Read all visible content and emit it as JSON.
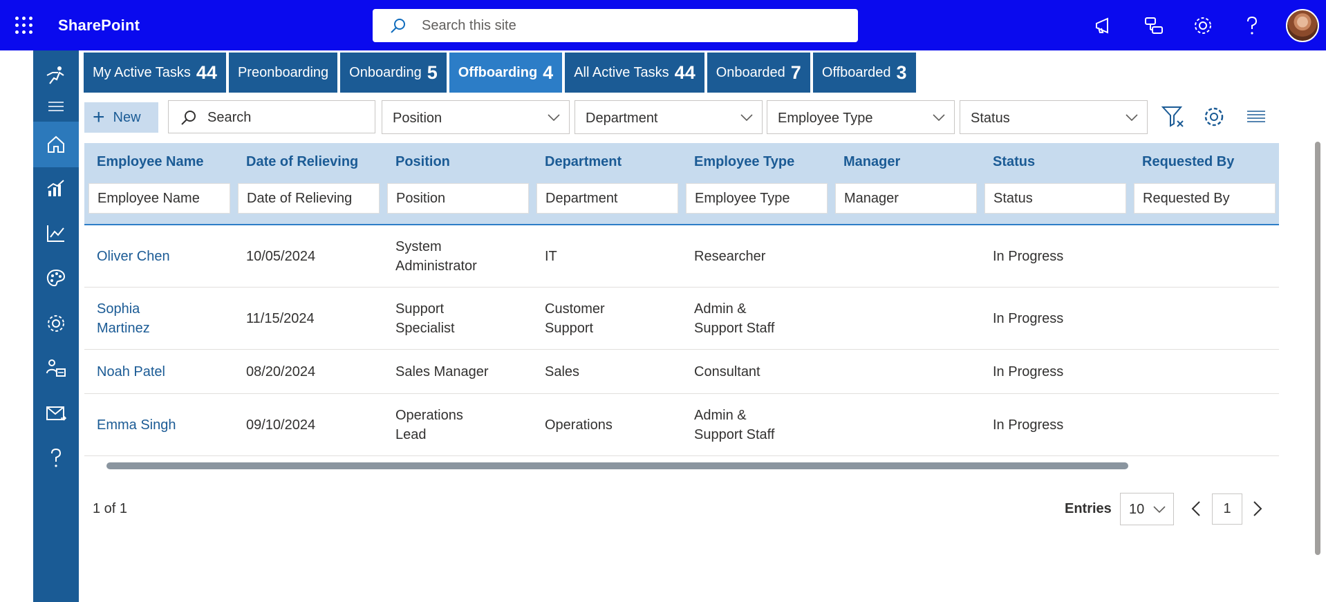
{
  "app": {
    "title": "SharePoint",
    "search_placeholder": "Search this site",
    "colors": {
      "suitebar": "#0a0aee",
      "rail": "#1a5b95",
      "tab": "#1b5b95",
      "tab_active": "#2c7dc7",
      "header_bg": "#c7dbee"
    }
  },
  "topbar_icons": [
    "megaphone-icon",
    "share-nodes-icon",
    "settings-icon",
    "help-icon"
  ],
  "rail_icons": [
    "logo-runner-icon",
    "menu-icon",
    "home-icon",
    "dashboard-chart-icon",
    "trend-chart-icon",
    "palette-icon",
    "settings-icon",
    "people-org-icon",
    "mail-send-icon",
    "help-icon"
  ],
  "tabs": [
    {
      "label": "My Active Tasks",
      "count": "44"
    },
    {
      "label": "Preonboarding",
      "count": ""
    },
    {
      "label": "Onboarding",
      "count": "5"
    },
    {
      "label": "Offboarding",
      "count": "4",
      "active": true
    },
    {
      "label": "All Active Tasks",
      "count": "44"
    },
    {
      "label": "Onboarded",
      "count": "7"
    },
    {
      "label": "Offboarded",
      "count": "3"
    }
  ],
  "toolbar": {
    "new_label": "New",
    "search_label": "Search",
    "filters": [
      "Position",
      "Department",
      "Employee Type",
      "Status"
    ],
    "icons": [
      "clear-filter-icon",
      "settings-icon",
      "align-lines-icon"
    ]
  },
  "table": {
    "columns": [
      "Employee Name",
      "Date of Relieving",
      "Position",
      "Department",
      "Employee Type",
      "Manager",
      "Status",
      "Requested By"
    ],
    "filter_placeholders": [
      "Employee Name",
      "Date of Relieving",
      "Position",
      "Department",
      "Employee Type",
      "Manager",
      "Status",
      "Requested By"
    ],
    "rows": [
      {
        "name": [
          "Oliver Chen"
        ],
        "date": "10/05/2024",
        "position": [
          "System",
          "Administrator"
        ],
        "department": [
          "IT"
        ],
        "type": [
          "Researcher"
        ],
        "manager": "",
        "status": "In Progress",
        "requested_by": ""
      },
      {
        "name": [
          "Sophia",
          "Martinez"
        ],
        "date": "11/15/2024",
        "position": [
          "Support",
          "Specialist"
        ],
        "department": [
          "Customer",
          "Support"
        ],
        "type": [
          "Admin &",
          "Support Staff"
        ],
        "manager": "",
        "status": "In Progress",
        "requested_by": ""
      },
      {
        "name": [
          "Noah Patel"
        ],
        "date": "08/20/2024",
        "position": [
          "Sales Manager"
        ],
        "department": [
          "Sales"
        ],
        "type": [
          "Consultant"
        ],
        "manager": "",
        "status": "In Progress",
        "requested_by": ""
      },
      {
        "name": [
          "Emma Singh"
        ],
        "date": "09/10/2024",
        "position": [
          "Operations",
          "Lead"
        ],
        "department": [
          "Operations"
        ],
        "type": [
          "Admin &",
          "Support Staff"
        ],
        "manager": "",
        "status": "In Progress",
        "requested_by": ""
      }
    ]
  },
  "footer": {
    "page_info": "1 of 1",
    "entries_label": "Entries",
    "entries_value": "10",
    "current_page": "1"
  }
}
